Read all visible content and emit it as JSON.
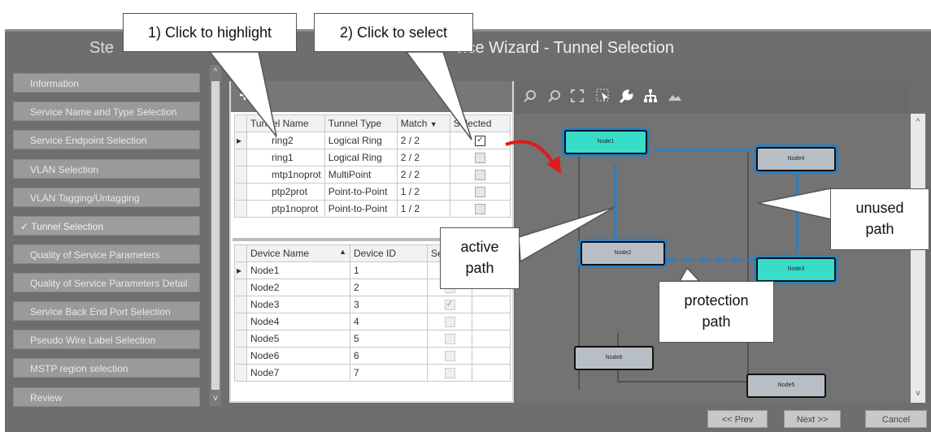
{
  "window": {
    "title_left": "Ste",
    "title_main": "vice Wizard - Tunnel Selection"
  },
  "sidebar": {
    "items": [
      {
        "label": "Information"
      },
      {
        "label": "Service Name and Type Selection"
      },
      {
        "label": "Service Endpoint Selection"
      },
      {
        "label": "VLAN Selection"
      },
      {
        "label": "VLAN Tagging/Untagging"
      },
      {
        "label": "Tunnel Selection",
        "check": "✓"
      },
      {
        "label": "Quality of Service Parameters"
      },
      {
        "label": "Quality of Service Parameters Detail"
      },
      {
        "label": "Service Back End Port Selection"
      },
      {
        "label": "Pseudo Wire Label Selection"
      },
      {
        "label": "MSTP region selection"
      },
      {
        "label": "Review"
      }
    ]
  },
  "tunnel_table": {
    "headers": {
      "name": "Tunnel Name",
      "type": "Tunnel Type",
      "match": "Match",
      "selected": "Selected"
    },
    "rows": [
      {
        "name": "ring2",
        "type": "Logical Ring",
        "match": "2 / 2",
        "checked": true
      },
      {
        "name": "ring1",
        "type": "Logical Ring",
        "match": "2 / 2",
        "checked": false
      },
      {
        "name": "mtp1noprot",
        "type": "MultiPoint",
        "match": "2 / 2",
        "checked": false
      },
      {
        "name": "ptp2prot",
        "type": "Point-to-Point",
        "match": "1 / 2",
        "checked": false
      },
      {
        "name": "ptp1noprot",
        "type": "Point-to-Point",
        "match": "1 / 2",
        "checked": false
      }
    ]
  },
  "device_table": {
    "headers": {
      "name": "Device Name",
      "id": "Device ID",
      "sel": "Se"
    },
    "rows": [
      {
        "name": "Node1",
        "id": "1",
        "checked": false
      },
      {
        "name": "Node2",
        "id": "2",
        "checked": false
      },
      {
        "name": "Node3",
        "id": "3",
        "checked": true
      },
      {
        "name": "Node4",
        "id": "4",
        "checked": false
      },
      {
        "name": "Node5",
        "id": "5",
        "checked": false
      },
      {
        "name": "Node6",
        "id": "6",
        "checked": false
      },
      {
        "name": "Node7",
        "id": "7",
        "checked": false
      }
    ]
  },
  "diagram": {
    "nodes": {
      "node1": "Node1",
      "node2": "Node2",
      "node3": "Node3",
      "node4": "Node4",
      "node5": "Node5",
      "node6": "Node6"
    },
    "colors": {
      "active": "#37ddc9",
      "inactive": "#b8bec6",
      "link": "#2d7fc1"
    }
  },
  "callouts": {
    "highlight": "1) Click to highlight",
    "select": "2) Click to select",
    "active_line1": "active",
    "active_line2": "path",
    "unused_line1": "unused",
    "unused_line2": "path",
    "protection_line1": "protection",
    "protection_line2": "path"
  },
  "buttons": {
    "prev": "<< Prev",
    "next": "Next >>",
    "cancel": "Cancel"
  },
  "glyphs": {
    "check": "✓",
    "sort_down": "▼",
    "sort_up": "▲",
    "row_marker": "▸",
    "scroll_up": "^",
    "scroll_down": "v"
  }
}
